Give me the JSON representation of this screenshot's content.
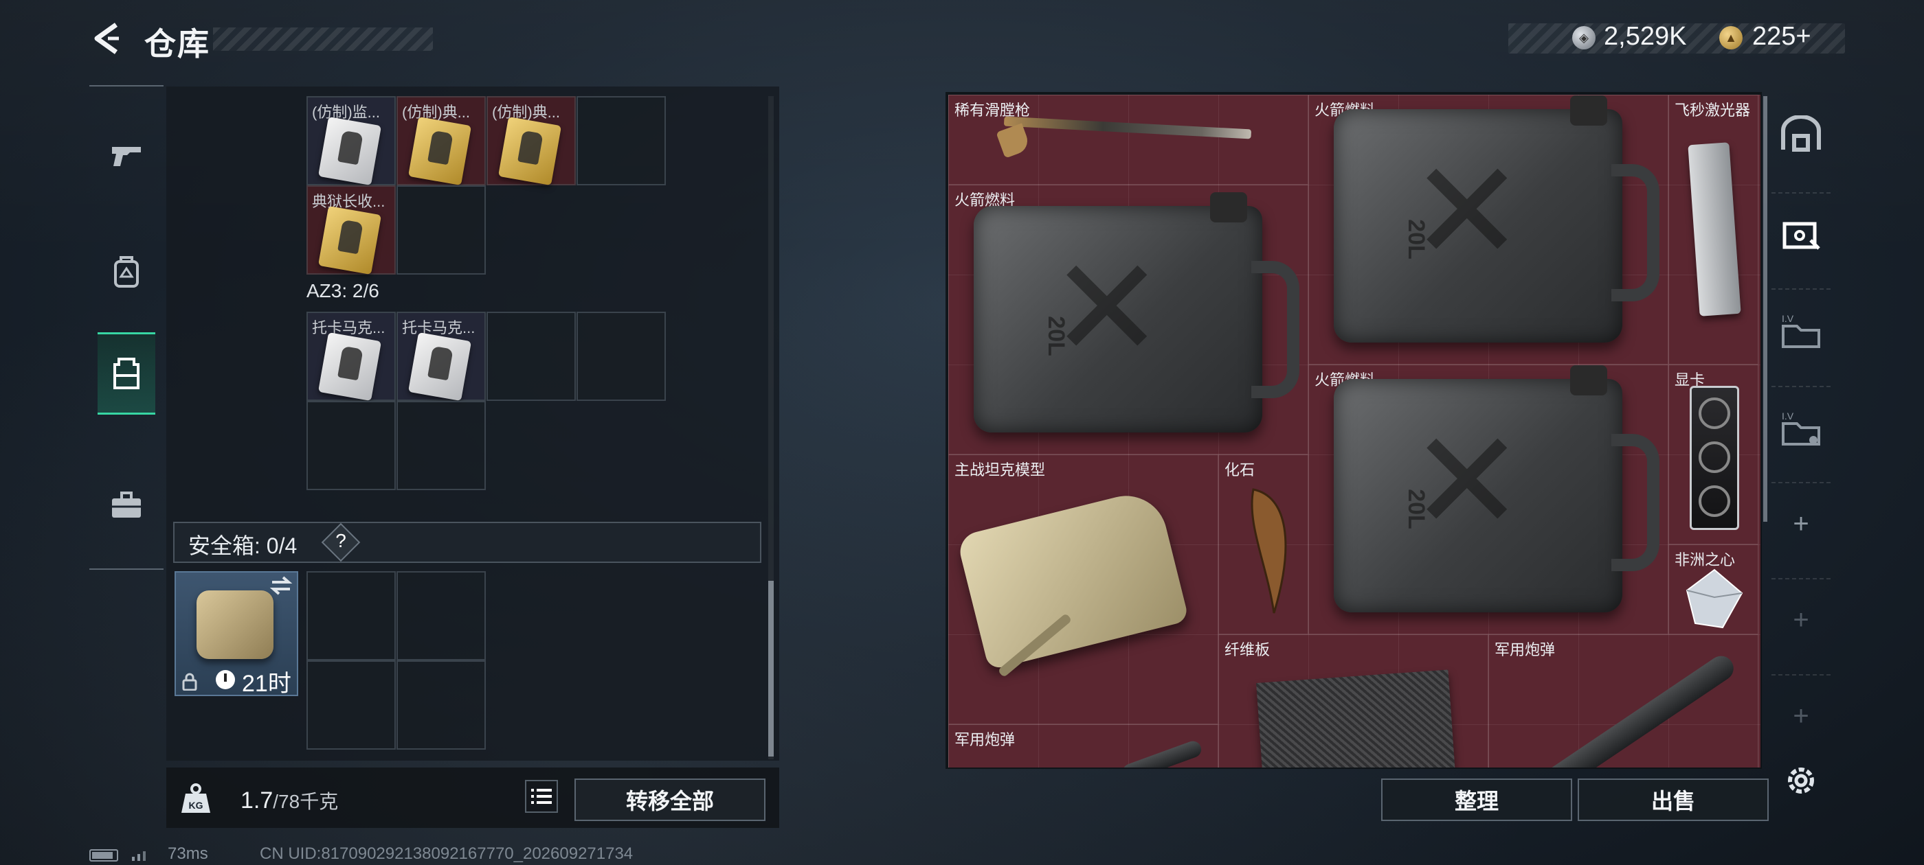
{
  "header": {
    "title": "仓库",
    "currency": [
      {
        "icon": "silver-coin-icon",
        "value": "2,529K"
      },
      {
        "icon": "gold-coin-icon",
        "value": "225+"
      }
    ]
  },
  "sidebar": {
    "items": [
      {
        "icon": "pistol-icon",
        "active": false
      },
      {
        "icon": "backpack-icon",
        "active": false
      },
      {
        "icon": "vest-icon",
        "active": true
      },
      {
        "icon": "toolbox-icon",
        "active": false
      }
    ]
  },
  "inventory": {
    "row1": [
      {
        "label": "(仿制)监...",
        "card": "white"
      },
      {
        "label": "(仿制)典...",
        "card": "gold"
      },
      {
        "label": "(仿制)典...",
        "card": "gold"
      }
    ],
    "row2": [
      {
        "label": "典狱长收...",
        "card": "gold"
      }
    ],
    "section_label": "AZ3: 2/6",
    "row3": [
      {
        "label": "托卡马克...",
        "card": "white"
      },
      {
        "label": "托卡马克...",
        "card": "white"
      }
    ]
  },
  "safebox": {
    "label": "安全箱: 0/4",
    "help": "?",
    "timer": "21时"
  },
  "weight": {
    "current": "1.7",
    "max": "/78千克"
  },
  "buttons": {
    "transfer_all": "转移全部",
    "sort": "整理",
    "sell": "出售"
  },
  "status": {
    "ping": "73ms",
    "uid": "CN UID:817090292138092167770_202609271734"
  },
  "stash": {
    "items": [
      {
        "label": "稀有滑膛枪"
      },
      {
        "label": "火箭燃料"
      },
      {
        "label": "飞秒激光器"
      },
      {
        "label": "火箭燃料"
      },
      {
        "label": "火箭燃料"
      },
      {
        "label": "显卡"
      },
      {
        "label": "主战坦克模型"
      },
      {
        "label": "化石"
      },
      {
        "label": "非洲之心"
      },
      {
        "label": "纤维板"
      },
      {
        "label": "军用炮弹"
      },
      {
        "label": "军用炮弹"
      }
    ],
    "can_text": "20L"
  },
  "colors": {
    "accent": "#37d6a3",
    "stash_bg": "#5a2630"
  }
}
